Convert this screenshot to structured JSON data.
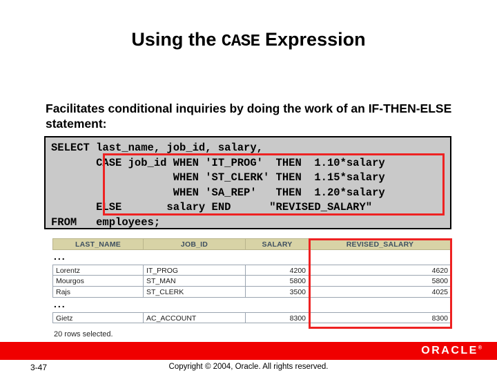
{
  "slide": {
    "title_prefix": "Using the ",
    "title_mono": "CASE",
    "title_suffix": " Expression",
    "lead_text": "Facilitates conditional inquiries by doing the work of an IF-THEN-ELSE statement:"
  },
  "code": {
    "sql": "SELECT last_name, job_id, salary,\n       CASE job_id WHEN 'IT_PROG'  THEN  1.10*salary\n                   WHEN 'ST_CLERK' THEN  1.15*salary\n                   WHEN 'SA_REP'   THEN  1.20*salary\n       ELSE       salary END      \"REVISED_SALARY\"\nFROM   employees;",
    "highlight_color": "#ee2222",
    "background_color": "#c9c9c9"
  },
  "result_grid": {
    "columns": [
      "LAST_NAME",
      "JOB_ID",
      "SALARY",
      "REVISED_SALARY"
    ],
    "ellipsis": "...",
    "rows": [
      {
        "last_name": "Lorentz",
        "job_id": "IT_PROG",
        "salary": "4200",
        "revised_salary": "4620"
      },
      {
        "last_name": "Mourgos",
        "job_id": "ST_MAN",
        "salary": "5800",
        "revised_salary": "5800"
      },
      {
        "last_name": "Rajs",
        "job_id": "ST_CLERK",
        "salary": "3500",
        "revised_salary": "4025"
      }
    ],
    "tail_rows": [
      {
        "last_name": "Gietz",
        "job_id": "AC_ACCOUNT",
        "salary": "8300",
        "revised_salary": "8300"
      }
    ],
    "status": "20 rows selected.",
    "header_background": "#d8d3a6",
    "header_text_color": "#3f5060",
    "highlight_color": "#ee2222"
  },
  "footer": {
    "page_number": "3-47",
    "copyright": "Copyright © 2004, Oracle. All rights reserved.",
    "logo_text": "ORACLE",
    "logo_mark": "®",
    "bar_color": "#f00000"
  }
}
